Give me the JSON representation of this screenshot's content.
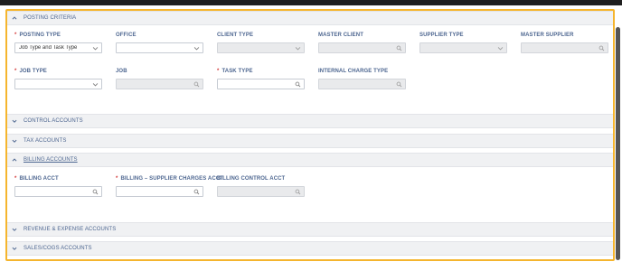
{
  "colors": {
    "accent_border": "#f5b52e",
    "label": "#4d6690",
    "required": "#d43a3a",
    "disabled_field": "#e9eaec"
  },
  "sections": {
    "posting_criteria": "POSTING CRITERIA",
    "control_accounts": "CONTROL ACCOUNTS",
    "tax_accounts": "TAX ACCOUNTS",
    "billing_accounts": "BILLING ACCOUNTS",
    "revenue_expense": "REVENUE & EXPENSE ACCOUNTS",
    "sales_cogs": "SALES/COGS ACCOUNTS"
  },
  "posting": {
    "posting_type": {
      "label": "POSTING TYPE",
      "value": "Job Type and Task Type",
      "required": "*"
    },
    "office": {
      "label": "OFFICE"
    },
    "client_type": {
      "label": "CLIENT TYPE"
    },
    "master_client": {
      "label": "MASTER CLIENT"
    },
    "supplier_type": {
      "label": "SUPPLIER TYPE"
    },
    "master_supplier": {
      "label": "MASTER SUPPLIER"
    },
    "job_type": {
      "label": "JOB TYPE",
      "required": "*"
    },
    "job": {
      "label": "JOB"
    },
    "task_type": {
      "label": "TASK TYPE",
      "required": "*"
    },
    "internal_charge_type": {
      "label": "INTERNAL CHARGE TYPE"
    }
  },
  "billing": {
    "billing_acct": {
      "label": "BILLING ACCT",
      "required": "*"
    },
    "supplier_charges_acct": {
      "label": "BILLING – SUPPLIER CHARGES ACCT",
      "required": "*"
    },
    "control_acct": {
      "label": "BILLING CONTROL ACCT"
    }
  },
  "icons": {
    "dropdown": "chevron-down-icon",
    "lookup": "search-icon",
    "collapse": "chevron-up-icon",
    "expand": "chevron-down-icon"
  }
}
